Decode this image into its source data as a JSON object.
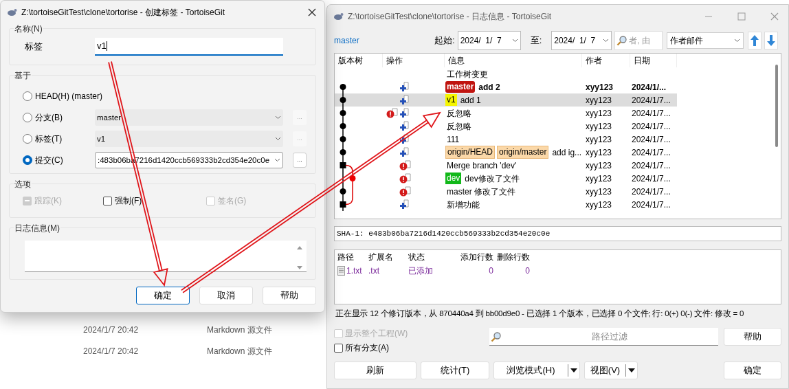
{
  "tag_dialog": {
    "title": "Z:\\tortoiseGitTest\\clone\\tortorise - 创建标签 - TortoiseGit",
    "name_group": {
      "legend": "名称(N)",
      "label": "标签",
      "value": "v1"
    },
    "base_group": {
      "legend": "基于",
      "options": [
        {
          "kind": "plain",
          "label": "HEAD(H) (master)",
          "selected": false
        },
        {
          "kind": "combo",
          "label": "分支(B)",
          "value": "master",
          "selected": false,
          "browse": "..."
        },
        {
          "kind": "combo",
          "label": "标签(T)",
          "value": "v1",
          "selected": false,
          "browse": "..."
        },
        {
          "kind": "combo",
          "label": "提交(C)",
          "value": ":483b06ba7216d1420ccb569333b2cd354e20c0e",
          "selected": true,
          "browse": "..."
        }
      ]
    },
    "options_group": {
      "legend": "选项",
      "checks": [
        {
          "label": "跟踪(K)",
          "checked": true,
          "disabled": true
        },
        {
          "label": "强制(F)",
          "checked": false,
          "disabled": false
        },
        {
          "label": "签名(G)",
          "checked": false,
          "disabled": true
        }
      ]
    },
    "message_group": {
      "legend": "日志信息(M)"
    },
    "buttons": [
      {
        "label": "确定",
        "default": true
      },
      {
        "label": "取消",
        "default": false
      },
      {
        "label": "帮助",
        "default": false
      }
    ]
  },
  "background_files": [
    {
      "date": "2024/1/7 20:42",
      "type": "Markdown 源文件"
    },
    {
      "date": "2024/1/7 20:42",
      "type": "Markdown 源文件"
    }
  ],
  "log_window": {
    "title": "Z:\\tortoiseGitTest\\clone\\tortorise - 日志信息 - TortoiseGit",
    "branch": "master",
    "from_label": "起始:",
    "from_date": "2024/  1/  7",
    "to_label": "至:",
    "to_date": "2024/  1/  7",
    "search_placeholder": "者, 由",
    "filter_field": "作者邮件",
    "columns": [
      "版本树",
      "操作",
      "信息",
      "作者",
      "日期"
    ],
    "rows": [
      {
        "graph": {
          "kind": "none"
        },
        "actions": [],
        "refs": [],
        "message": "工作树变更",
        "bold": false,
        "selected": false
      },
      {
        "graph": {
          "kind": "head"
        },
        "actions": [
          {
            "kind": "add"
          }
        ],
        "refs": [
          {
            "label": "master",
            "kind": "head"
          }
        ],
        "message": "add 2",
        "author": "xyy123",
        "date": "2024/1/...",
        "bold": true,
        "selected": false
      },
      {
        "graph": {
          "kind": "circle"
        },
        "actions": [
          {
            "kind": "add"
          }
        ],
        "refs": [
          {
            "label": "v1",
            "kind": "tag"
          }
        ],
        "message": "add 1",
        "author": "xyy123",
        "date": "2024/1/7...",
        "bold": false,
        "selected": true
      },
      {
        "graph": {
          "kind": "circle"
        },
        "actions": [
          {
            "kind": "warn"
          },
          {
            "kind": "add"
          }
        ],
        "refs": [],
        "message": "反忽略",
        "author": "xyy123",
        "date": "2024/1/7...",
        "bold": false,
        "selected": false
      },
      {
        "graph": {
          "kind": "circle"
        },
        "actions": [
          {
            "kind": "add"
          }
        ],
        "refs": [],
        "message": "反忽略",
        "author": "xyy123",
        "date": "2024/1/7...",
        "bold": false,
        "selected": false
      },
      {
        "graph": {
          "kind": "circle"
        },
        "actions": [
          {
            "kind": "add"
          }
        ],
        "refs": [],
        "message": "111",
        "author": "xyy123",
        "date": "2024/1/7...",
        "bold": false,
        "selected": false
      },
      {
        "graph": {
          "kind": "circle"
        },
        "actions": [
          {
            "kind": "add"
          }
        ],
        "refs": [
          {
            "label": "origin/HEAD",
            "kind": "remote"
          },
          {
            "label": "origin/master",
            "kind": "remote"
          }
        ],
        "message": "add ig...",
        "author": "xyy123",
        "date": "2024/1/7...",
        "bold": false,
        "selected": false
      },
      {
        "graph": {
          "kind": "merge"
        },
        "actions": [
          {
            "kind": "warn"
          }
        ],
        "refs": [],
        "message": "Merge branch 'dev'",
        "author": "xyy123",
        "date": "2024/1/7...",
        "bold": false,
        "selected": false
      },
      {
        "graph": {
          "kind": "branch"
        },
        "actions": [
          {
            "kind": "warn"
          }
        ],
        "refs": [
          {
            "label": "dev",
            "kind": "branch"
          }
        ],
        "message": "dev修改了文件",
        "author": "xyy123",
        "date": "2024/1/7...",
        "bold": false,
        "selected": false
      },
      {
        "graph": {
          "kind": "lane"
        },
        "actions": [
          {
            "kind": "warn"
          }
        ],
        "refs": [],
        "message": "master 修改了文件",
        "author": "xyy123",
        "date": "2024/1/7...",
        "bold": false,
        "selected": false
      },
      {
        "graph": {
          "kind": "fork"
        },
        "actions": [
          {
            "kind": "add"
          }
        ],
        "refs": [],
        "message": "新增功能",
        "author": "xyy123",
        "date": "2024/1/7...",
        "bold": false,
        "selected": false
      }
    ],
    "sha": "SHA-1: e483b06ba7216d1420ccb569333b2cd354e20c0e",
    "file_columns": [
      "路径",
      "扩展名",
      "状态",
      "添加行数",
      "删除行数"
    ],
    "files": [
      {
        "path": "1.txt",
        "ext": ".txt",
        "status": "已添加",
        "added": "0",
        "deleted": "0"
      }
    ],
    "status": "正在显示 12 个修订版本，从 870440a4 到 bb00d9e0 - 已选择 1 个版本，已选择 0 个文件; 行: 0(+) 0(-) 文件: 修改 = 0",
    "checks": [
      {
        "label": "显示整个工程(W)",
        "checked": false,
        "disabled": true
      },
      {
        "label": "所有分支(A)",
        "checked": false,
        "disabled": false
      }
    ],
    "path_filter_placeholder": "路径过滤",
    "help_button": "帮助",
    "buttons": [
      {
        "label": "刷新",
        "split": false
      },
      {
        "label": "统计(T)",
        "split": false
      },
      {
        "label": "浏览模式(H)",
        "split": true
      },
      {
        "label": "视图(V)",
        "split": true
      }
    ],
    "ok_button": "确定"
  }
}
